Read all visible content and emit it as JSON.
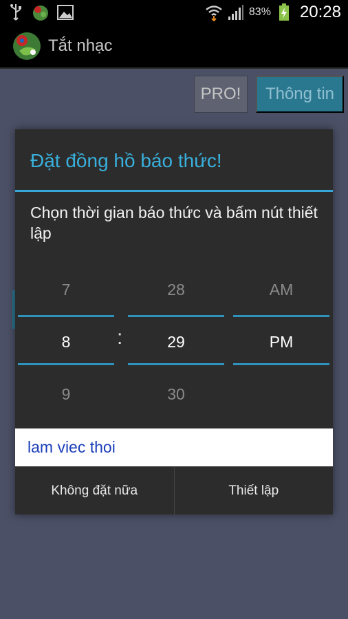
{
  "status_bar": {
    "icons": [
      "usb-icon",
      "app-notification-icon",
      "gallery-icon",
      "wifi-icon",
      "signal-icon",
      "battery-charging-icon"
    ],
    "battery_percent": "83%",
    "time": "20:28"
  },
  "action_bar": {
    "title": "Tắt nhạc"
  },
  "background": {
    "pro_label": "PRO!",
    "info_label": "Thông tin"
  },
  "dialog": {
    "title": "Đặt đồng hồ báo thức!",
    "message": "Chọn thời gian báo thức và bấm nút thiết lập",
    "picker": {
      "hour": {
        "prev": "7",
        "current": "8",
        "next": "9"
      },
      "separator": ":",
      "minute": {
        "prev": "28",
        "current": "29",
        "next": "30"
      },
      "ampm": {
        "prev": "AM",
        "current": "PM",
        "next": ""
      }
    },
    "note_value": "lam viec thoi",
    "cancel_label": "Không đặt nữa",
    "set_label": "Thiết lập"
  },
  "colors": {
    "accent": "#39b0dc",
    "background": "#4c5066",
    "dialog": "#2c2c2c"
  }
}
